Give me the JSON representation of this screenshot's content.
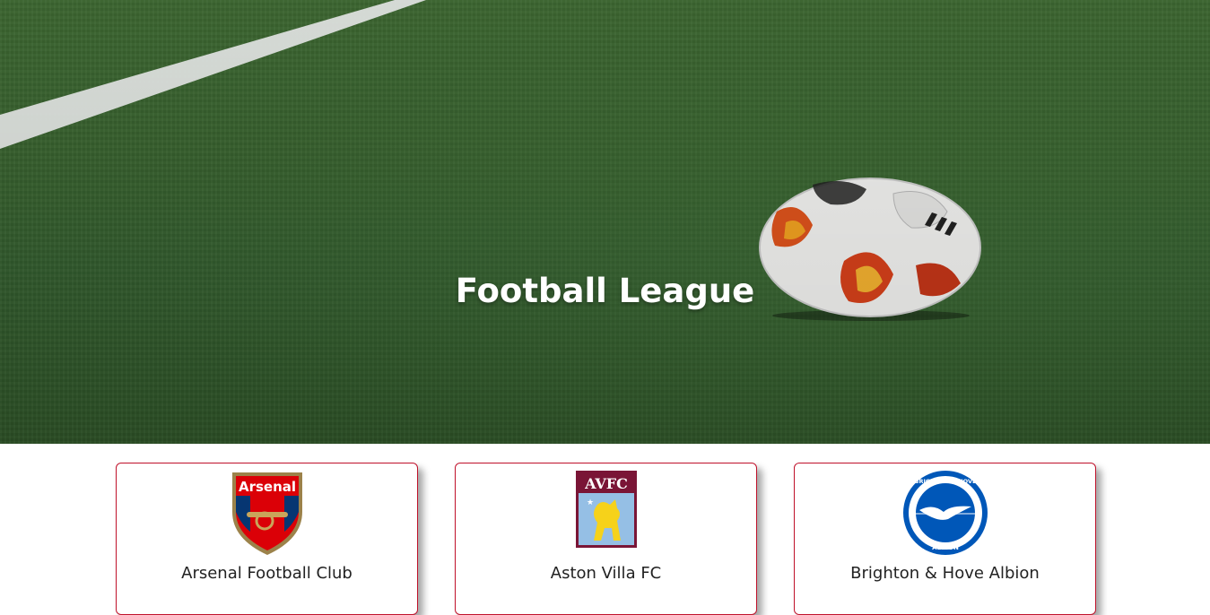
{
  "hero": {
    "title": "Football League"
  },
  "teams": [
    {
      "name": "Arsenal Football Club",
      "crest_text": "Arsenal",
      "subtitle": ""
    },
    {
      "name": "Aston Villa FC",
      "crest_text": "AVFC",
      "subtitle": ""
    },
    {
      "name": "Brighton & Hove Albion",
      "crest_text_top": "BRIGHTON & HOVE",
      "crest_text_bottom": "ALBION",
      "subtitle": ""
    }
  ],
  "colors": {
    "card_border": "#c0122b",
    "grass": "#3a6530",
    "arsenal_red": "#db0007",
    "villa_claret": "#7a1536",
    "villa_blue": "#95bfe5",
    "brighton_blue": "#0057b8"
  }
}
